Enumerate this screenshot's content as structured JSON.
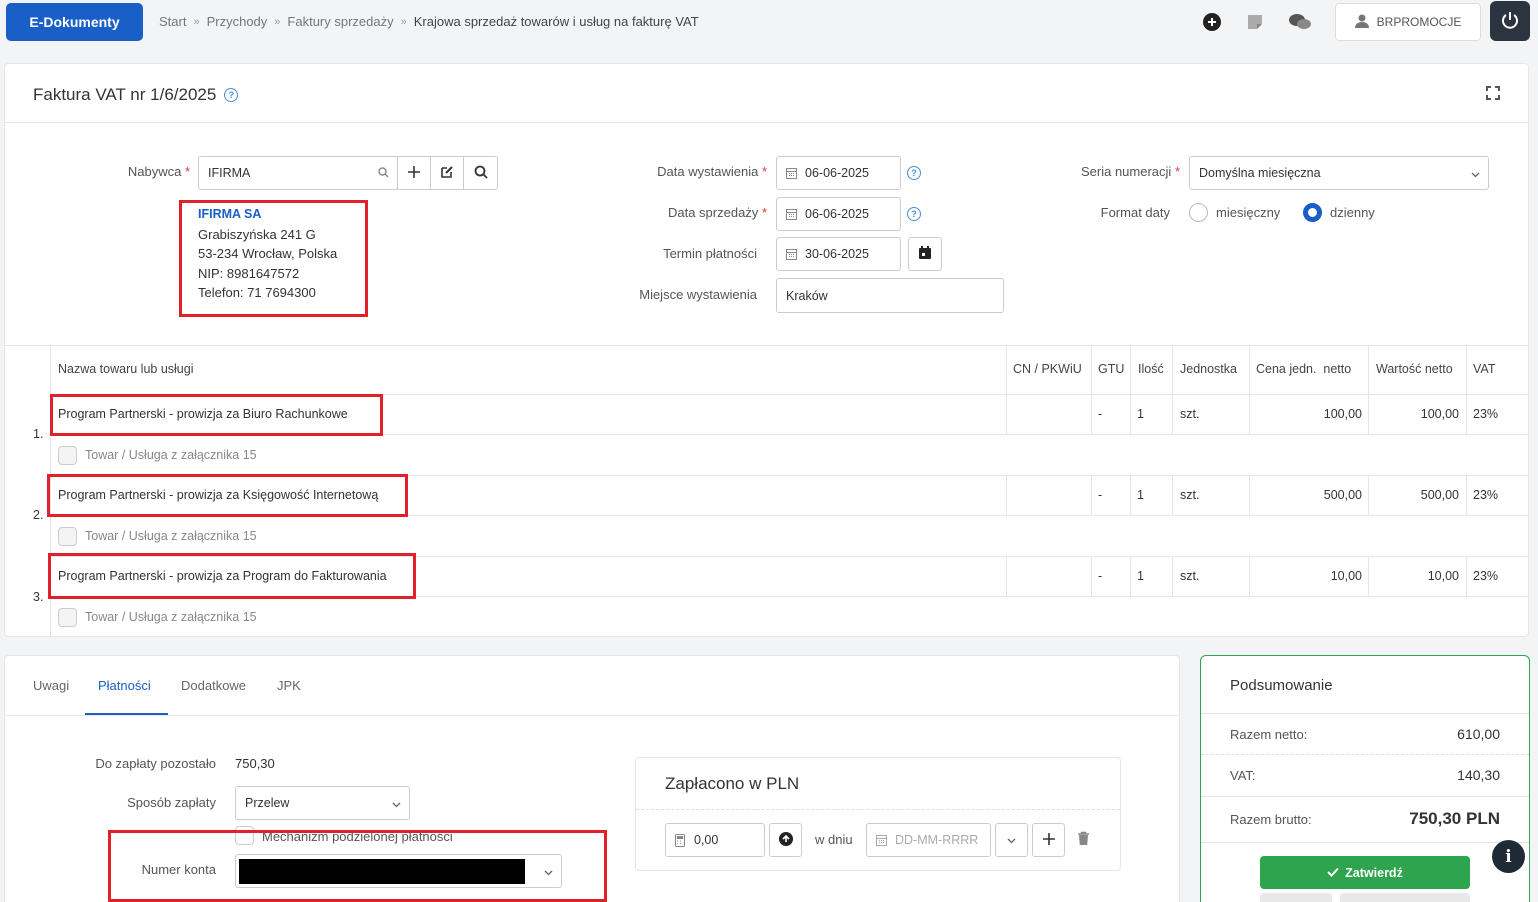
{
  "app": {
    "brand": "E-Dokumenty"
  },
  "breadcrumb": [
    "Start",
    "Przychody",
    "Faktury sprzedaży",
    "Krajowa sprzedaż towarów i usług na fakturę VAT"
  ],
  "topbar": {
    "user": "BRPROMOCJE",
    "icons": [
      "plus-circle-icon",
      "note-icon",
      "chat-icon",
      "user-icon",
      "power-icon"
    ]
  },
  "invoice": {
    "title": "Faktura VAT nr 1/6/2025"
  },
  "buyer": {
    "label": "Nabywca",
    "value": "IFIRMA",
    "name": "IFIRMA SA",
    "street": "Grabiszyńska 241 G",
    "city": "53-234 Wrocław, Polska",
    "nip": "NIP: 8981647572",
    "phone": "Telefon: 71 7694300"
  },
  "dates": {
    "issue_label": "Data wystawienia",
    "issue": "06-06-2025",
    "sale_label": "Data sprzedaży",
    "sale": "06-06-2025",
    "due_label": "Termin płatności",
    "due": "30-06-2025",
    "place_label": "Miejsce wystawienia",
    "place": "Kraków"
  },
  "series": {
    "label": "Seria numeracji",
    "value": "Domyślna miesięczna",
    "format_label": "Format daty",
    "opt_monthly": "miesięczny",
    "opt_daily": "dzienny",
    "selected": "dzienny"
  },
  "table": {
    "headers": {
      "name": "Nazwa towaru lub usługi",
      "cn": "CN / PKWiU",
      "gtu": "GTU",
      "qty": "Ilość",
      "unit": "Jednostka",
      "price": "Cena jedn.  netto",
      "net": "Wartość netto",
      "vat": "VAT"
    },
    "attachment_label": "Towar / Usługa z załącznika 15",
    "rows": [
      {
        "no": "1.",
        "name": "Program Partnerski - prowizja za Biuro Rachunkowe",
        "gtu": "-",
        "qty": "1",
        "unit": "szt.",
        "price": "100,00",
        "net": "100,00",
        "vat": "23%"
      },
      {
        "no": "2.",
        "name": "Program Partnerski - prowizja za Księgowość Internetową",
        "gtu": "-",
        "qty": "1",
        "unit": "szt.",
        "price": "500,00",
        "net": "500,00",
        "vat": "23%"
      },
      {
        "no": "3.",
        "name": "Program Partnerski - prowizja za Program do Fakturowania",
        "gtu": "-",
        "qty": "1",
        "unit": "szt.",
        "price": "10,00",
        "net": "10,00",
        "vat": "23%"
      }
    ]
  },
  "tabs": [
    "Uwagi",
    "Płatności",
    "Dodatkowe",
    "JPK"
  ],
  "active_tab": "Płatności",
  "payment": {
    "remaining_label": "Do zapłaty pozostało",
    "remaining": "750,30",
    "method_label": "Sposób zapłaty",
    "method": "Przelew",
    "split_label": "Mechanizm podzielonej płatności",
    "account_label": "Numer konta"
  },
  "paid": {
    "title": "Zapłacono w PLN",
    "amount": "0,00",
    "on_day": "w dniu",
    "date_placeholder": "DD-MM-RRRR"
  },
  "summary": {
    "title": "Podsumowanie",
    "net_label": "Razem netto:",
    "net": "610,00",
    "vat_label": "VAT:",
    "vat": "140,30",
    "gross_label": "Razem brutto:",
    "gross": "750,30 PLN",
    "confirm": "Zatwierdź"
  },
  "colors": {
    "accent": "#1a5fc7",
    "confirm": "#2ea44f",
    "highlight": "#e0202a"
  }
}
